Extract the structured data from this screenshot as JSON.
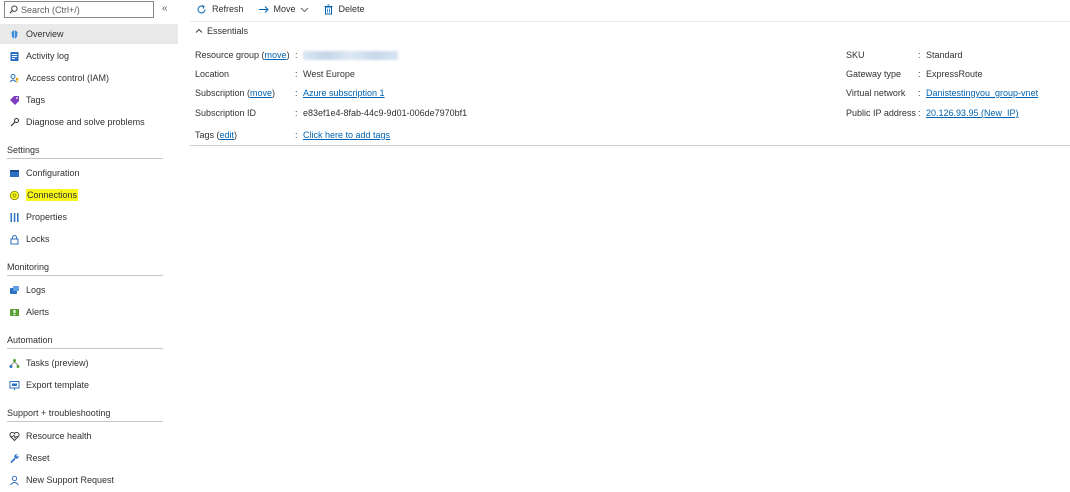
{
  "search": {
    "placeholder": "Search (Ctrl+/)"
  },
  "collapse": {
    "label": "«"
  },
  "sidebar": {
    "top_items": [
      {
        "label": "Overview",
        "icon": "overview-icon"
      },
      {
        "label": "Activity log",
        "icon": "activity-log-icon"
      },
      {
        "label": "Access control (IAM)",
        "icon": "iam-icon"
      },
      {
        "label": "Tags",
        "icon": "tag-icon"
      },
      {
        "label": "Diagnose and solve problems",
        "icon": "wrench-icon"
      }
    ],
    "sections": [
      {
        "title": "Settings",
        "items": [
          {
            "label": "Configuration"
          },
          {
            "label": "Connections"
          },
          {
            "label": "Properties"
          },
          {
            "label": "Locks"
          }
        ]
      },
      {
        "title": "Monitoring",
        "items": [
          {
            "label": "Logs"
          },
          {
            "label": "Alerts"
          }
        ]
      },
      {
        "title": "Automation",
        "items": [
          {
            "label": "Tasks (preview)"
          },
          {
            "label": "Export template"
          }
        ]
      },
      {
        "title": "Support + troubleshooting",
        "items": [
          {
            "label": "Resource health"
          },
          {
            "label": "Reset"
          },
          {
            "label": "New Support Request"
          }
        ]
      }
    ]
  },
  "toolbar": {
    "refresh": "Refresh",
    "move": "Move",
    "delete": "Delete"
  },
  "essentials": {
    "title": "Essentials",
    "left": {
      "resource_group_label": "Resource group",
      "resource_group_move": "move",
      "location_label": "Location",
      "location_value": "West Europe",
      "subscription_label": "Subscription",
      "subscription_move": "move",
      "subscription_value": "Azure subscription 1",
      "subscription_id_label": "Subscription ID",
      "subscription_id_value": "e83ef1e4-8fab-44c9-9d01-006de7970bf1",
      "tags_label": "Tags",
      "tags_edit": "edit",
      "tags_value": "Click here to add tags"
    },
    "right": {
      "sku_label": "SKU",
      "sku_value": "Standard",
      "gateway_type_label": "Gateway type",
      "gateway_type_value": "ExpressRoute",
      "virtual_network_label": "Virtual network",
      "virtual_network_value": "Danistestingyou_group-vnet",
      "public_ip_label": "Public IP address",
      "public_ip_value": "20.126.93.95 (New_IP)"
    }
  },
  "colors": {
    "link": "#0063b1",
    "highlight": "#f7f71a",
    "active_bg": "#e9e9e9"
  }
}
